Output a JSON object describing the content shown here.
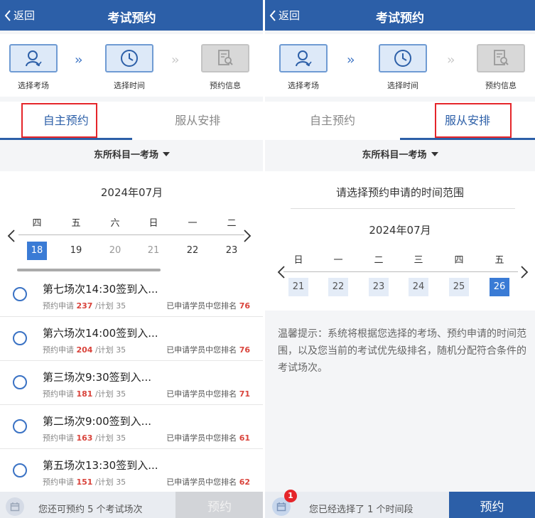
{
  "header": {
    "back_label": "返回",
    "title": "考试预约"
  },
  "steps": [
    {
      "label": "选择考场",
      "icon": "person-icon"
    },
    {
      "label": "选择时间",
      "icon": "clock-icon"
    },
    {
      "label": "预约信息",
      "icon": "document-search-icon"
    }
  ],
  "tabs": [
    {
      "label": "自主预约"
    },
    {
      "label": "服从安排"
    }
  ],
  "exam_site": "东所科目一考场",
  "left": {
    "calendar": {
      "month": "2024年07月",
      "weekdays": [
        "四",
        "五",
        "六",
        "日",
        "一",
        "二"
      ],
      "days": [
        "18",
        "19",
        "20",
        "21",
        "22",
        "23"
      ]
    },
    "sessions": [
      {
        "title": "第七场次14:30签到入...",
        "apply_label": "预约申请",
        "apply": "237",
        "plan_label": "/计划",
        "plan": "35",
        "rank_label": "已申请学员中您排名",
        "rank": "76"
      },
      {
        "title": "第六场次14:00签到入...",
        "apply_label": "预约申请",
        "apply": "204",
        "plan_label": "/计划",
        "plan": "35",
        "rank_label": "已申请学员中您排名",
        "rank": "76"
      },
      {
        "title": "第三场次9:30签到入...",
        "apply_label": "预约申请",
        "apply": "181",
        "plan_label": "/计划",
        "plan": "35",
        "rank_label": "已申请学员中您排名",
        "rank": "71"
      },
      {
        "title": "第二场次9:00签到入...",
        "apply_label": "预约申请",
        "apply": "163",
        "plan_label": "/计划",
        "plan": "35",
        "rank_label": "已申请学员中您排名",
        "rank": "61"
      },
      {
        "title": "第五场次13:30签到入...",
        "apply_label": "预约申请",
        "apply": "151",
        "plan_label": "/计划",
        "plan": "35",
        "rank_label": "已申请学员中您排名",
        "rank": "62"
      }
    ],
    "footer": {
      "text": "您还可预约 5 个考试场次",
      "button": "预约"
    }
  },
  "right": {
    "range_title": "请选择预约申请的时间范围",
    "calendar": {
      "month": "2024年07月",
      "weekdays": [
        "日",
        "一",
        "二",
        "三",
        "四",
        "五"
      ],
      "days": [
        "21",
        "22",
        "23",
        "24",
        "25",
        "26"
      ]
    },
    "tip": "温馨提示：系统将根据您选择的考场、预约申请的时间范围，以及您当前的考试优先级排名，随机分配符合条件的考试场次。",
    "footer": {
      "badge": "1",
      "text": "您已经选择了 1 个时间段",
      "button": "预约"
    }
  },
  "colors": {
    "primary": "#2c5fa8",
    "selected_day": "#3a7bd5",
    "highlight": "#e5252a",
    "count_red": "#d9433b"
  }
}
